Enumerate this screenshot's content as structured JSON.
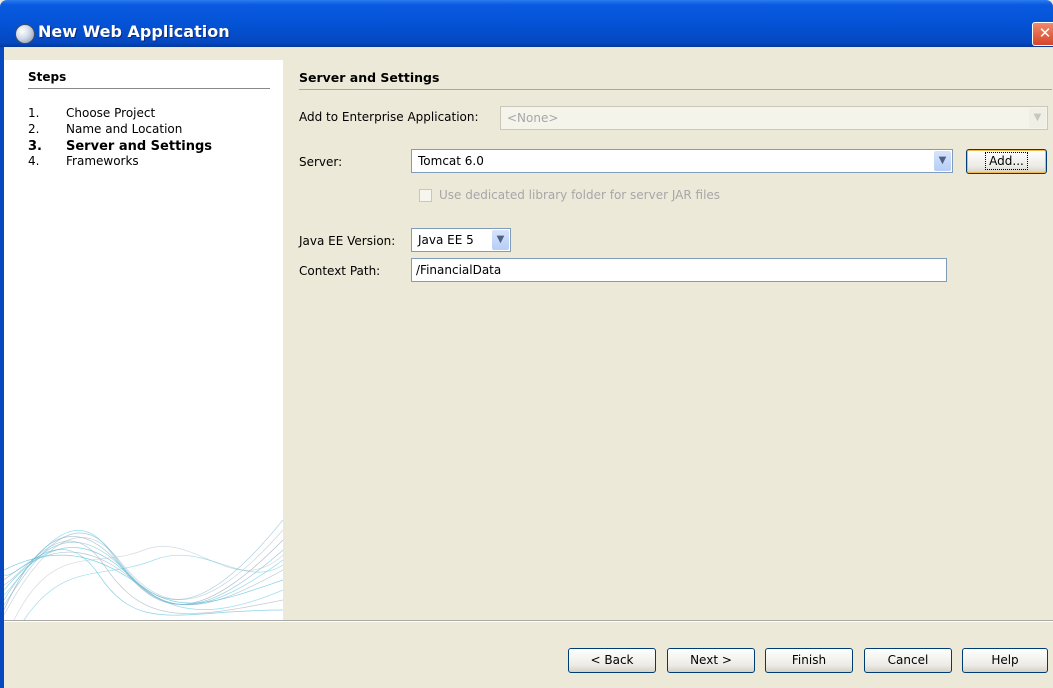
{
  "window": {
    "title": "New Web Application",
    "close_label": "✕"
  },
  "steps": {
    "title": "Steps",
    "items": [
      {
        "num": "1.",
        "label": "Choose Project"
      },
      {
        "num": "2.",
        "label": "Name and Location"
      },
      {
        "num": "3.",
        "label": "Server and Settings"
      },
      {
        "num": "4.",
        "label": "Frameworks"
      }
    ]
  },
  "main": {
    "title": "Server and Settings",
    "enterprise": {
      "label": "Add to Enterprise Application:",
      "value": "<None>"
    },
    "server": {
      "label": "Server:",
      "value": "Tomcat 6.0",
      "add_label": "Add..."
    },
    "dedicated": {
      "label": "Use dedicated library folder for server JAR files"
    },
    "javaee": {
      "label": "Java EE Version:",
      "value": "Java EE 5"
    },
    "context": {
      "label": "Context Path:",
      "value": "/FinancialData"
    }
  },
  "buttons": {
    "back": "< Back",
    "next": "Next >",
    "finish": "Finish",
    "cancel": "Cancel",
    "help": "Help"
  },
  "icons": {
    "title": "netbeans-globe-icon",
    "dropdown": "chevron-down-icon"
  },
  "colors": {
    "titlebar": "#0453d6",
    "dialog_bg": "#ece9d8",
    "field_border": "#7f9db9"
  }
}
